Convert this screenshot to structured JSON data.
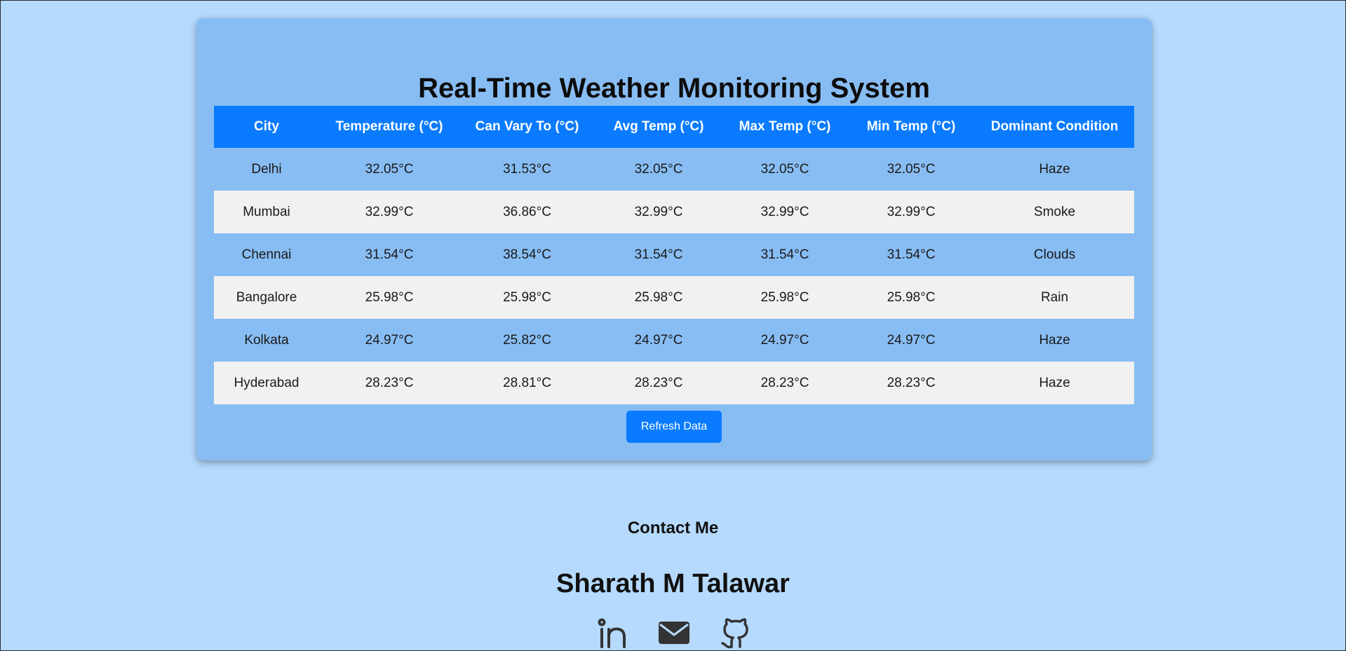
{
  "page": {
    "title": "Real-Time Weather Monitoring System"
  },
  "table": {
    "headers": [
      "City",
      "Temperature (°C)",
      "Can Vary To (°C)",
      "Avg Temp (°C)",
      "Max Temp (°C)",
      "Min Temp (°C)",
      "Dominant Condition"
    ],
    "rows": [
      [
        "Delhi",
        "32.05°C",
        "31.53°C",
        "32.05°C",
        "32.05°C",
        "32.05°C",
        "Haze"
      ],
      [
        "Mumbai",
        "32.99°C",
        "36.86°C",
        "32.99°C",
        "32.99°C",
        "32.99°C",
        "Smoke"
      ],
      [
        "Chennai",
        "31.54°C",
        "38.54°C",
        "31.54°C",
        "31.54°C",
        "31.54°C",
        "Clouds"
      ],
      [
        "Bangalore",
        "25.98°C",
        "25.98°C",
        "25.98°C",
        "25.98°C",
        "25.98°C",
        "Rain"
      ],
      [
        "Kolkata",
        "24.97°C",
        "25.82°C",
        "24.97°C",
        "24.97°C",
        "24.97°C",
        "Haze"
      ],
      [
        "Hyderabad",
        "28.23°C",
        "28.81°C",
        "28.23°C",
        "28.23°C",
        "28.23°C",
        "Haze"
      ]
    ]
  },
  "actions": {
    "refresh_label": "Refresh Data"
  },
  "contact": {
    "heading": "Contact Me",
    "name": "Sharath M Talawar",
    "links": [
      {
        "icon": "linkedin-icon"
      },
      {
        "icon": "envelope-icon"
      },
      {
        "icon": "github-icon"
      }
    ]
  },
  "colors": {
    "page_background": "#b5dafd",
    "card_background": "#88bdf3",
    "accent": "#0a7bff",
    "alt_row": "#f1f1f1",
    "icon": "#333333"
  }
}
